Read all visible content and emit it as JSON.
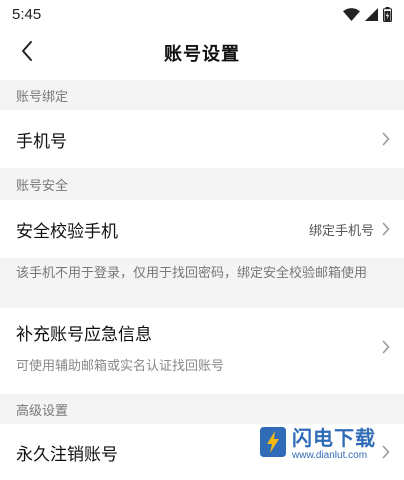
{
  "status_bar": {
    "time": "5:45"
  },
  "header": {
    "title": "账号设置"
  },
  "sections": {
    "binding": {
      "title": "账号绑定",
      "phone_label": "手机号"
    },
    "security": {
      "title": "账号安全",
      "verify_label": "安全校验手机",
      "verify_value": "绑定手机号",
      "note": "该手机不用于登录，仅用于找回密码，绑定安全校验邮箱使用",
      "emergency_label": "补充账号应急信息",
      "emergency_sub": "可使用辅助邮箱或实名认证找回账号"
    },
    "advanced": {
      "title": "高级设置",
      "delete_label": "永久注销账号"
    }
  },
  "watermark": {
    "title": "闪电下载",
    "url": "www.dianlut.com"
  },
  "colors": {
    "section_bg": "#f4f4f4",
    "watermark": "#1e5fb0"
  }
}
